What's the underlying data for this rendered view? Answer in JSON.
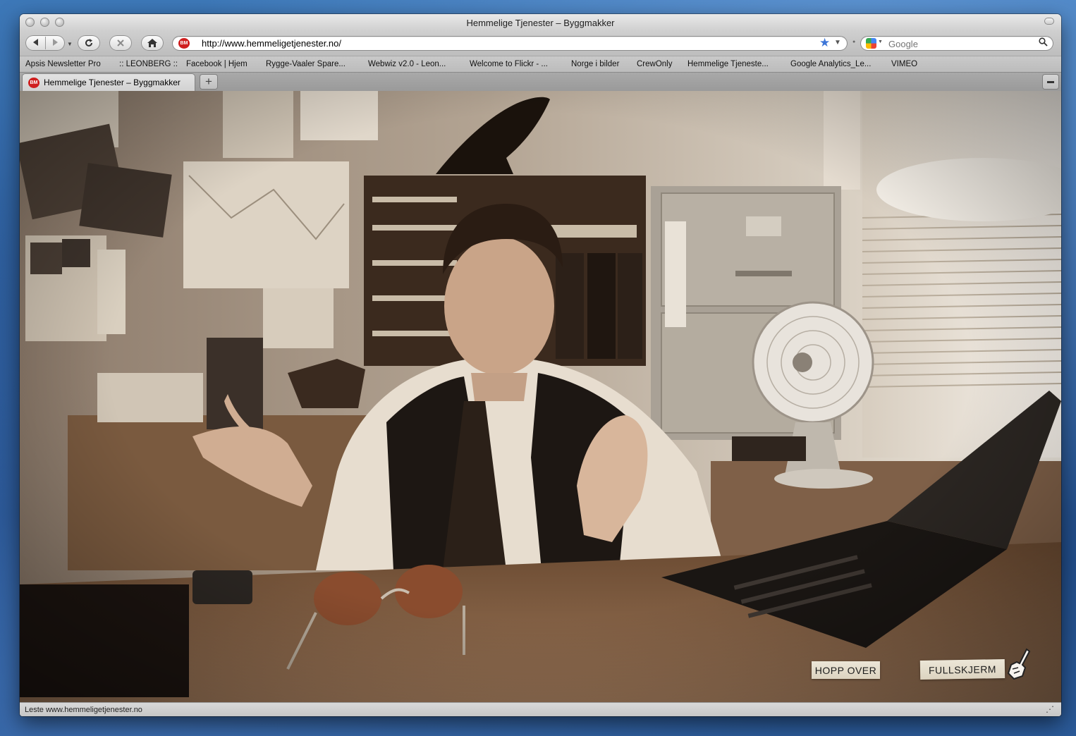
{
  "window": {
    "title": "Hemmelige Tjenester – Byggmakker"
  },
  "toolbar": {
    "back_icon": "back-arrow-icon",
    "forward_icon": "forward-arrow-icon",
    "reload_icon": "reload-icon",
    "stop_icon": "stop-icon",
    "home_icon": "home-icon"
  },
  "address": {
    "url": "http://www.hemmeligetjenester.no/",
    "site_badge": "BM"
  },
  "search": {
    "placeholder": "Google"
  },
  "bookmarks": [
    "Apsis Newsletter Pro",
    ":: LEONBERG ::",
    "Facebook | Hjem",
    "Rygge-Vaaler Spare...",
    "Webwiz v2.0 - Leon...",
    "Welcome to Flickr - ...",
    "Norge i bilder",
    "CrewOnly",
    "Hemmelige Tjeneste...",
    "Google Analytics_Le...",
    "VIMEO"
  ],
  "tabs": [
    {
      "label": "Hemmelige Tjenester – Byggmakker",
      "badge": "BM"
    }
  ],
  "page": {
    "skip_label": "HOPP OVER",
    "fullscreen_label": "FULLSKJERM"
  },
  "status": {
    "text": "Leste www.hemmeligetjenester.no"
  },
  "colors": {
    "brand_red": "#cf1f1f",
    "bookmark_star": "#3d76d8",
    "sepia_mid": "#8a7563"
  }
}
